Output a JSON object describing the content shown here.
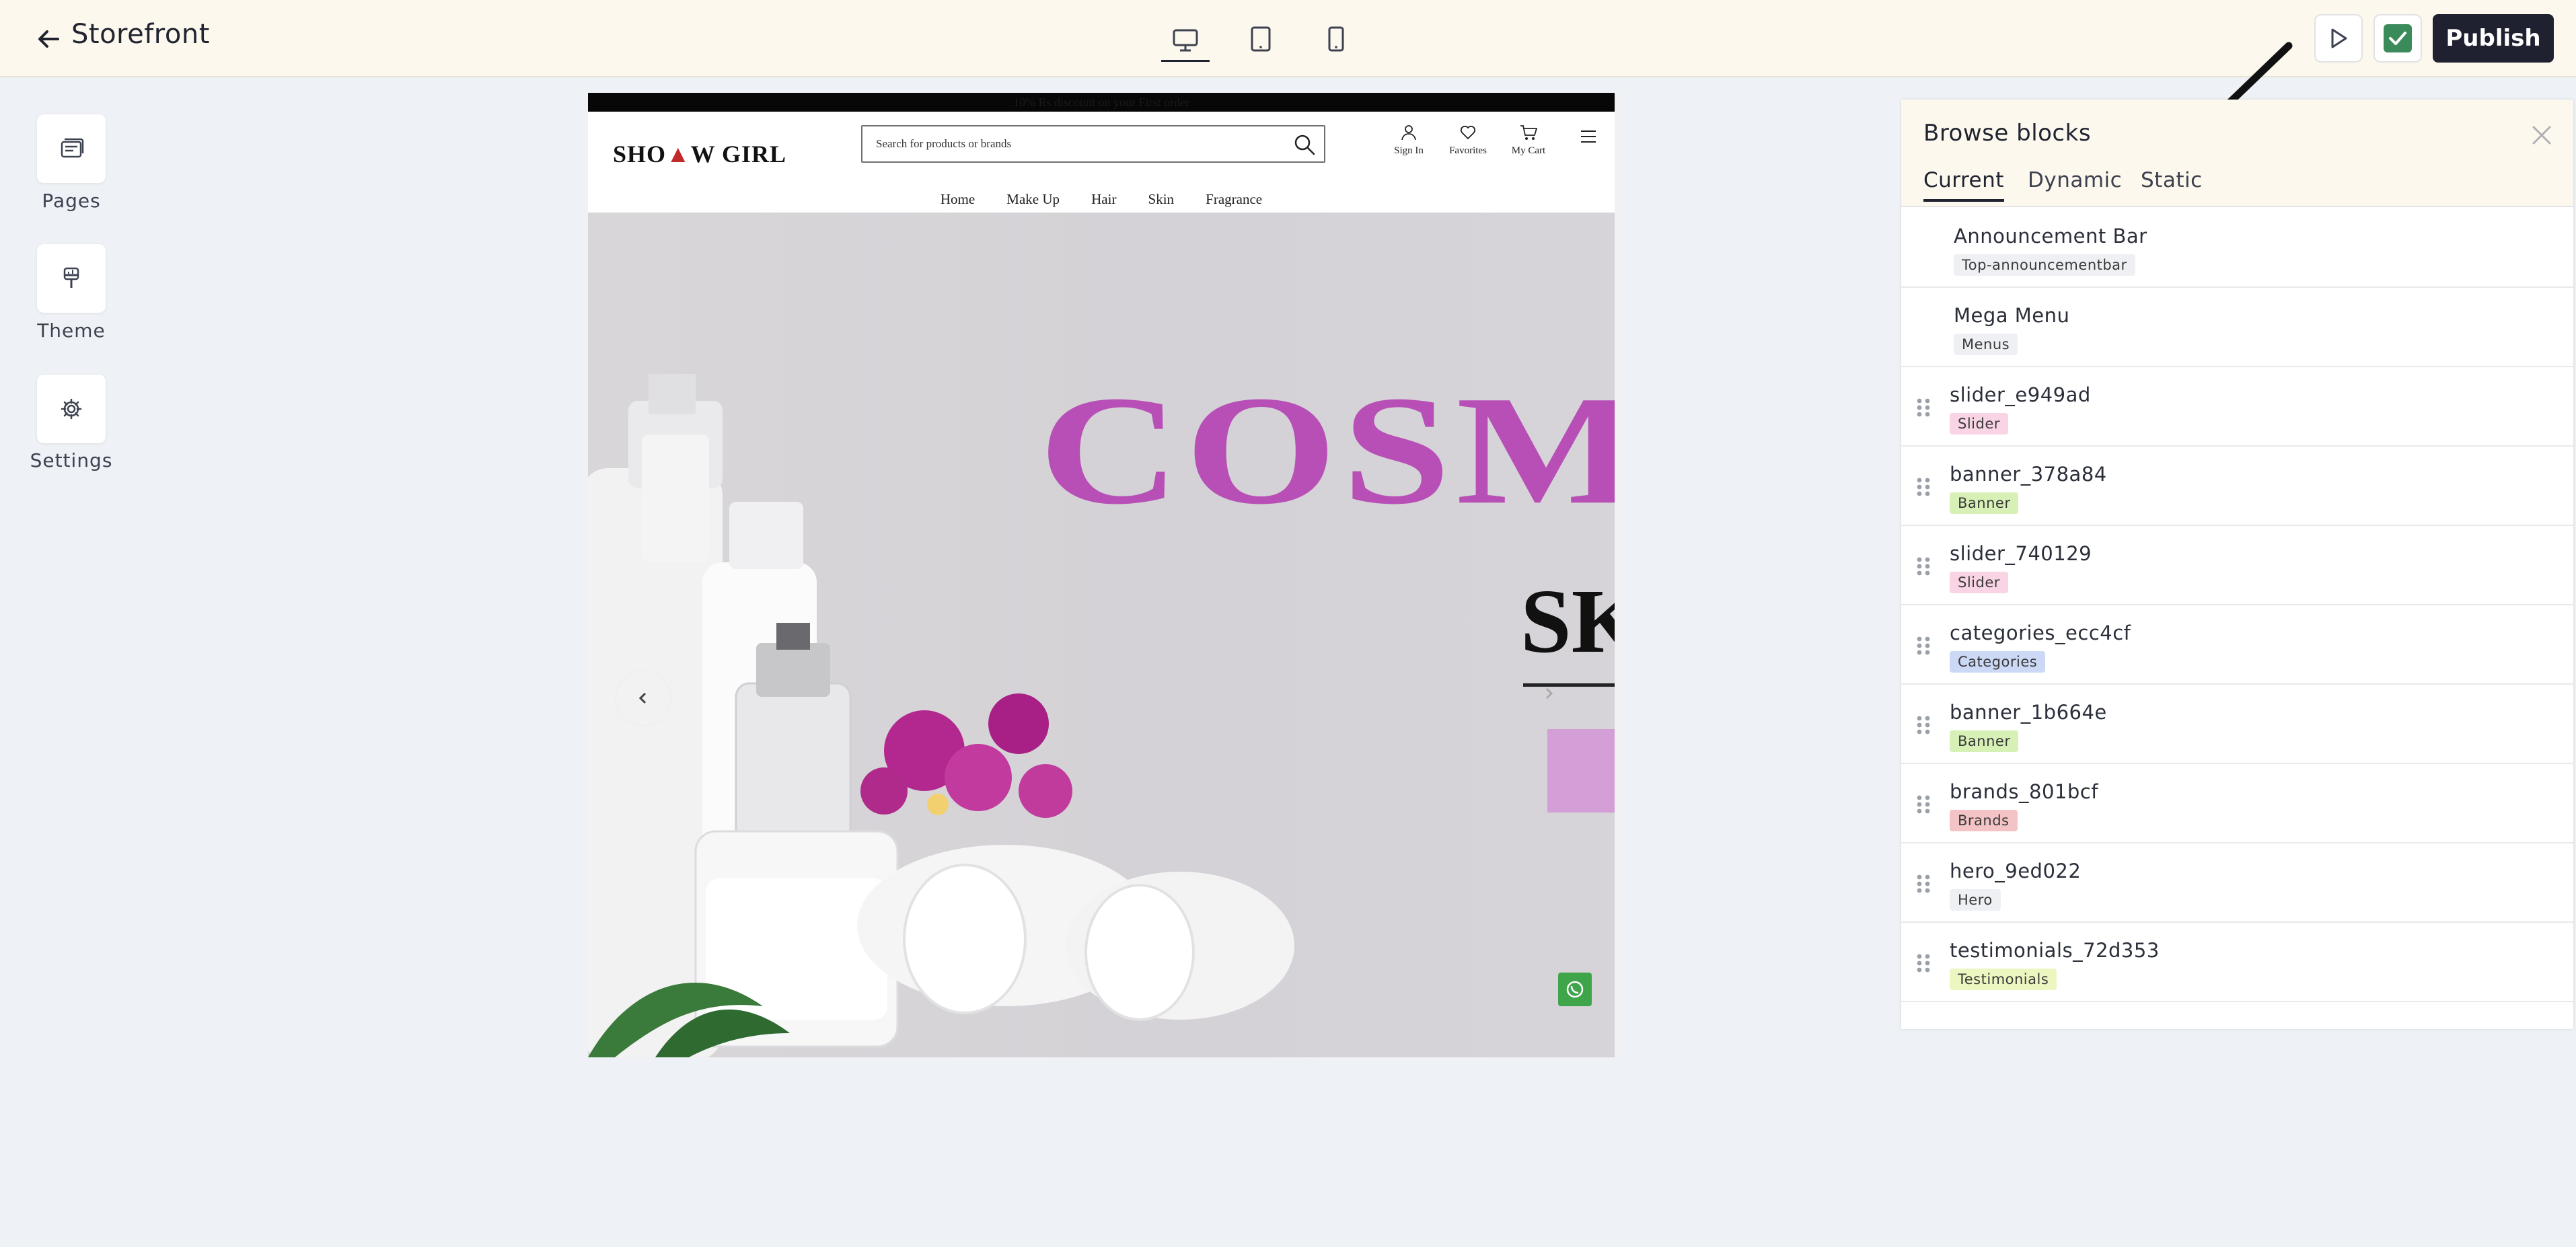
{
  "app": {
    "title": "Storefront",
    "publish_label": "Publish",
    "device_views": [
      "desktop",
      "tablet",
      "mobile"
    ],
    "active_device": "desktop"
  },
  "sidebar": {
    "items": [
      {
        "label": "Pages",
        "icon": "pages-icon"
      },
      {
        "label": "Theme",
        "icon": "brush-icon"
      },
      {
        "label": "Settings",
        "icon": "gear-icon"
      }
    ]
  },
  "preview": {
    "announcement": "10% Rs discount on your First order",
    "logo_text_a": "SHO",
    "logo_text_b": "W GIRL",
    "search_placeholder": "Search for products or brands",
    "header_icons": [
      "Sign In",
      "Favorites",
      "My Cart"
    ],
    "nav": [
      "Home",
      "Make Up",
      "Hair",
      "Skin",
      "Fragrance"
    ],
    "hero_word": "COSME",
    "hero_sub": "SK"
  },
  "panel": {
    "title": "Browse blocks",
    "tabs": [
      "Current",
      "Dynamic",
      "Static"
    ],
    "active_tab": "Current",
    "blocks": [
      {
        "name": "Announcement Bar",
        "tag": "Top-announcementbar",
        "tag_color": "#eef0f4",
        "draggable": false
      },
      {
        "name": "Mega Menu",
        "tag": "Menus",
        "tag_color": "#eef0f4",
        "draggable": false
      },
      {
        "name": "slider_e949ad",
        "tag": "Slider",
        "tag_color": "#f8d4e4",
        "draggable": true
      },
      {
        "name": "banner_378a84",
        "tag": "Banner",
        "tag_color": "#d7f0b6",
        "draggable": true
      },
      {
        "name": "slider_740129",
        "tag": "Slider",
        "tag_color": "#f8d4e4",
        "draggable": true
      },
      {
        "name": "categories_ecc4cf",
        "tag": "Categories",
        "tag_color": "#cbd8f6",
        "draggable": true
      },
      {
        "name": "banner_1b664e",
        "tag": "Banner",
        "tag_color": "#d7f0b6",
        "draggable": true
      },
      {
        "name": "brands_801bcf",
        "tag": "Brands",
        "tag_color": "#f4c3c6",
        "draggable": true
      },
      {
        "name": "hero_9ed022",
        "tag": "Hero",
        "tag_color": "#eef0f4",
        "draggable": true
      },
      {
        "name": "testimonials_72d353",
        "tag": "Testimonials",
        "tag_color": "#ecf6c0",
        "draggable": true
      }
    ]
  }
}
